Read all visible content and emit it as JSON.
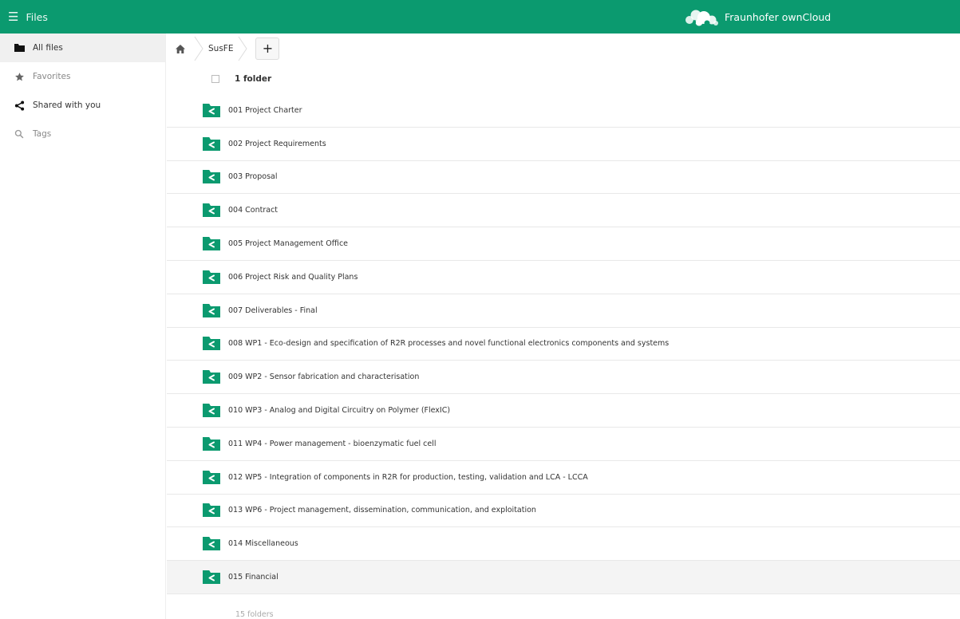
{
  "header": {
    "app_name": "Files",
    "brand": "Fraunhofer ownCloud"
  },
  "icons": {
    "menu": "hamburger-menu-icon",
    "cloud": "owncloud-logo-icon",
    "folder": "shared-folder-icon",
    "home": "home-icon"
  },
  "colors": {
    "brand": "#0b9a6f",
    "folder": "#0b9a6f"
  },
  "sidebar": {
    "items": [
      {
        "label": "All files"
      },
      {
        "label": "Favorites"
      },
      {
        "label": "Shared with you"
      },
      {
        "label": "Tags"
      }
    ]
  },
  "breadcrumb": {
    "current": "SusFE"
  },
  "new_button": {
    "label": "+"
  },
  "list": {
    "header_count": "1 folder",
    "footer_count": "15 folders",
    "files": [
      "001 Project Charter",
      "002 Project Requirements",
      "003 Proposal",
      "004 Contract",
      "005 Project Management Office",
      "006 Project Risk and Quality Plans",
      "007 Deliverables - Final",
      "008 WP1 - Eco-design and specification of R2R processes and novel functional electronics components and systems",
      "009 WP2 - Sensor fabrication and characterisation",
      "010 WP3 - Analog and Digital Circuitry on Polymer (FlexIC)",
      "011 WP4 - Power management - bioenzymatic fuel cell",
      "012 WP5 - Integration of components in R2R for production, testing, validation and LCA - LCCA",
      "013 WP6 - Project management, dissemination, communication, and exploitation",
      "014 Miscellaneous",
      "015 Financial"
    ]
  }
}
